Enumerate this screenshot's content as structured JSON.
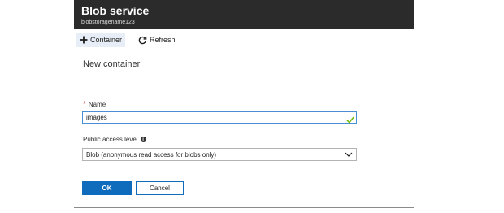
{
  "blade": {
    "title": "Blob service",
    "subtitle": "blobstoragename123"
  },
  "toolbar": {
    "container_label": "Container",
    "refresh_label": "Refresh"
  },
  "form": {
    "heading": "New container",
    "name": {
      "required_mark": "*",
      "label": "Name",
      "value": "images"
    },
    "access": {
      "label": "Public access level",
      "selected": "Blob (anonymous read access for blobs only)"
    },
    "ok_label": "OK",
    "cancel_label": "Cancel"
  },
  "colors": {
    "header_bg": "#2b2b2b",
    "accent": "#0f6cbd",
    "valid_check": "#6bb700",
    "required": "#d13438"
  },
  "icons": [
    "plus-icon",
    "refresh-icon",
    "checkmark-icon",
    "info-icon",
    "chevron-down-icon"
  ]
}
